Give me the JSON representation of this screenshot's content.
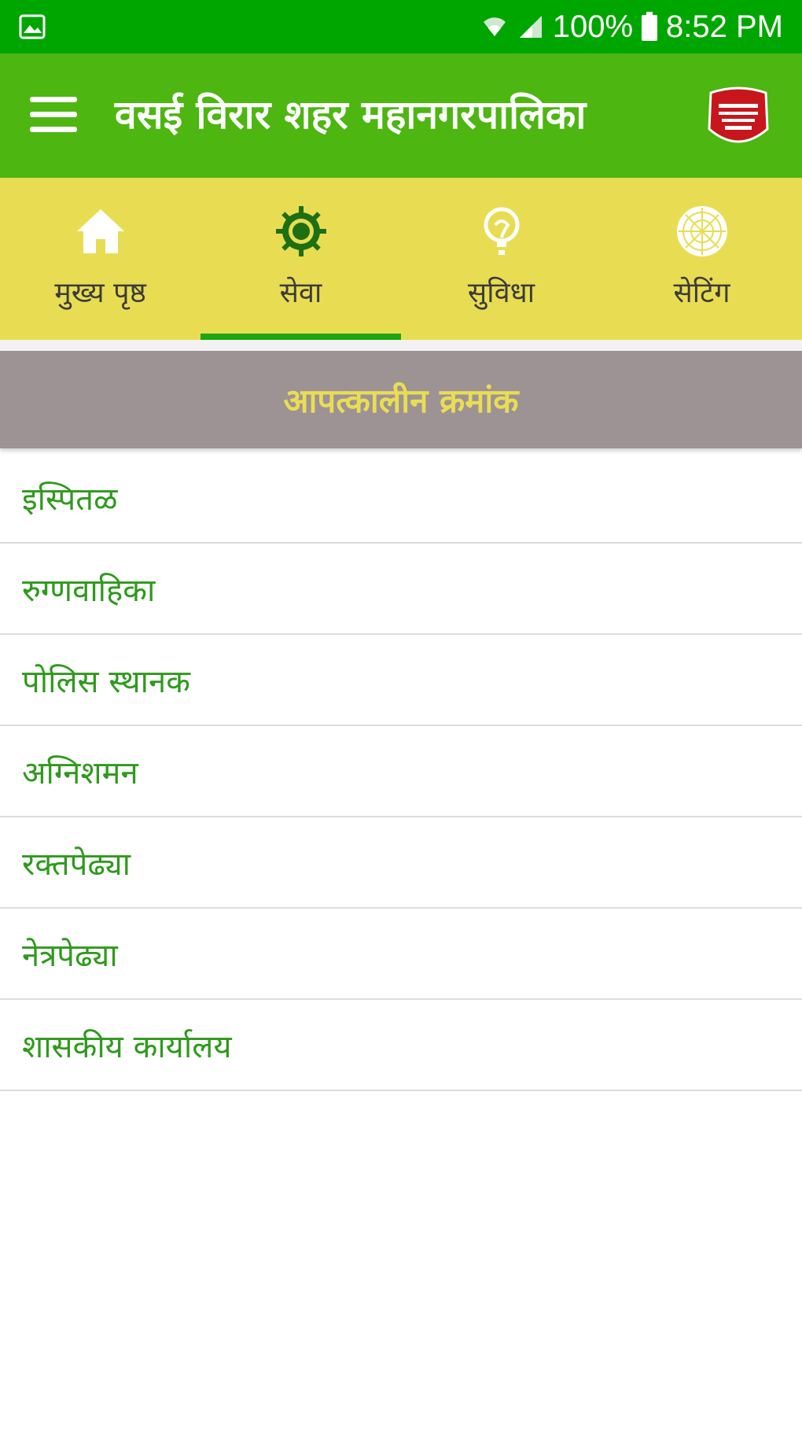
{
  "status_bar": {
    "battery": "100%",
    "time": "8:52 PM",
    "icons": [
      "gallery-icon",
      "wifi-icon",
      "signal-icon",
      "battery-icon"
    ]
  },
  "app_bar": {
    "title": "वसई विरार शहर महानगरपालिका",
    "menu_icon": "hamburger-menu-icon",
    "logo_icon": "municipal-logo"
  },
  "tabs": [
    {
      "label": "मुख्य पृष्ठ",
      "icon": "home-icon",
      "selected": false
    },
    {
      "label": "सेवा",
      "icon": "gear-icon",
      "selected": true
    },
    {
      "label": "सुविधा",
      "icon": "bulb-icon",
      "selected": false
    },
    {
      "label": "सेटिंग",
      "icon": "settings-icon",
      "selected": false
    }
  ],
  "section": {
    "title": "आपत्कालीन क्रमांक"
  },
  "list_items": [
    {
      "label": "इस्पितळ"
    },
    {
      "label": "रुग्णवाहिका"
    },
    {
      "label": "पोलिस स्थानक"
    },
    {
      "label": "अग्निशमन"
    },
    {
      "label": "रक्तपेढ्या"
    },
    {
      "label": "नेत्रपेढ्या"
    },
    {
      "label": "शासकीय कार्यालय"
    }
  ],
  "colors": {
    "status_bar": "#00a600",
    "app_bar": "#4db611",
    "tab_bar": "#e8dd52",
    "section_header": "#9d9294",
    "list_text": "#2e9a1c",
    "indicator": "#1fa412"
  }
}
